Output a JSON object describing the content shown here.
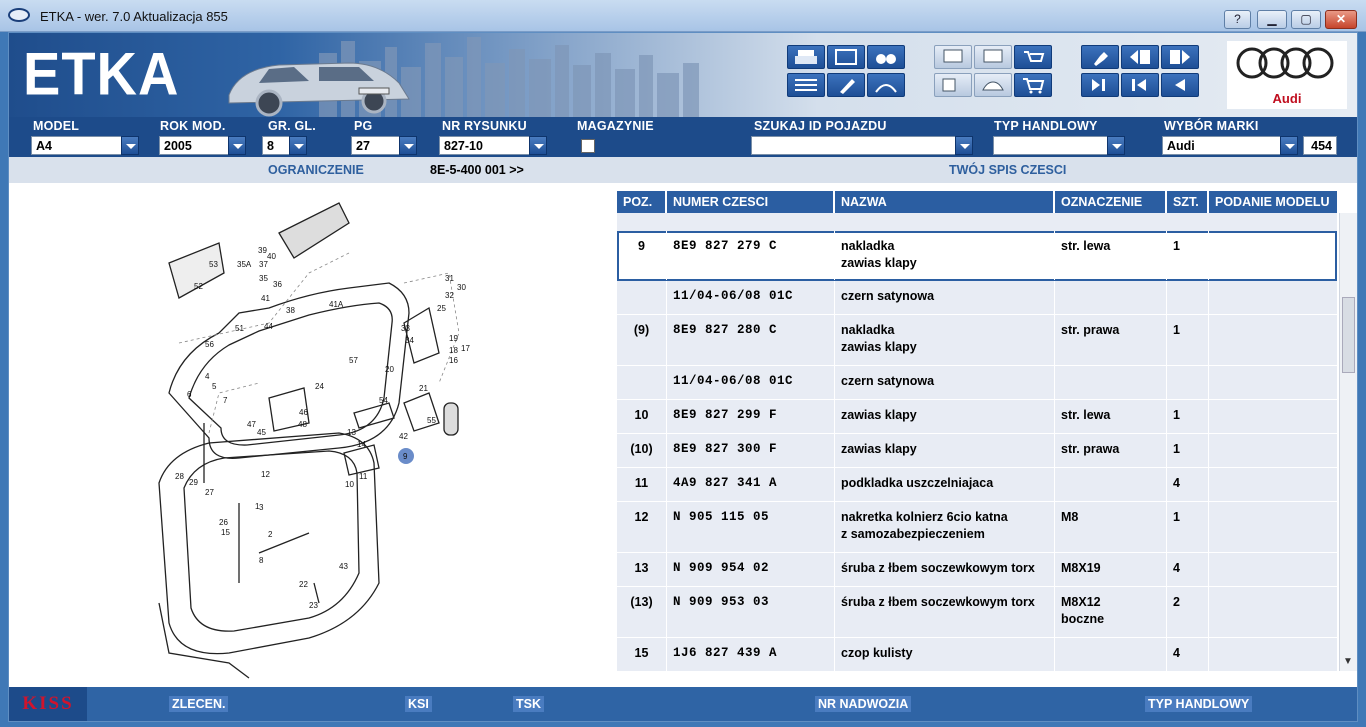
{
  "window": {
    "title": "ETKA - wer. 7.0 Aktualizacja 855",
    "help": "?",
    "minimize": "▁",
    "maximize": "▢",
    "close": "✕"
  },
  "banner": {
    "logo": "ETKA",
    "brand": "Audi"
  },
  "fields": {
    "model": {
      "label": "MODEL",
      "value": "A4"
    },
    "rok_mod": {
      "label": "ROK MOD.",
      "value": "2005"
    },
    "gr_gl": {
      "label": "GR. GL.",
      "value": "8"
    },
    "pg": {
      "label": "PG",
      "value": "27"
    },
    "nr_rysunku": {
      "label": "NR RYSUNKU",
      "value": "827-10"
    },
    "magazynie": {
      "label": "MAGAZYNIE"
    },
    "szukaj": {
      "label": "SZUKAJ ID POJAZDU",
      "value": ""
    },
    "typ_handlowy": {
      "label": "TYP HANDLOWY",
      "value": ""
    },
    "wybor_marki": {
      "label": "WYBÓR MARKI",
      "value": "Audi",
      "code": "454"
    }
  },
  "info": {
    "ograniczenie_label": "OGRANICZENIE",
    "ograniczenie_value": "8E-5-400 001 >>",
    "spis_label": "TWÓJ SPIS CZESCI"
  },
  "table": {
    "headers": [
      "POZ.",
      "NUMER CZESCI",
      "NAZWA",
      "OZNACZENIE",
      "SZT.",
      "PODANIE MODELU"
    ],
    "rows": [
      {
        "poz": "9",
        "numer": "8E9 827 279 C",
        "nazwa": "nakladka",
        "nazwa2": "zawias klapy",
        "ozn": "str. lewa",
        "ozn2": "",
        "szt": "1"
      },
      {
        "poz": "",
        "numer": "11/04-06/08 01C",
        "nazwa": "czern satynowa",
        "nazwa2": "",
        "ozn": "",
        "ozn2": "",
        "szt": ""
      },
      {
        "poz": "(9)",
        "numer": "8E9 827 280 C",
        "nazwa": "nakladka",
        "nazwa2": "zawias klapy",
        "ozn": "str. prawa",
        "ozn2": "",
        "szt": "1"
      },
      {
        "poz": "",
        "numer": "11/04-06/08 01C",
        "nazwa": "czern satynowa",
        "nazwa2": "",
        "ozn": "",
        "ozn2": "",
        "szt": ""
      },
      {
        "poz": "10",
        "numer": "8E9 827 299 F",
        "nazwa": "zawias klapy",
        "nazwa2": "",
        "ozn": "str. lewa",
        "ozn2": "",
        "szt": "1"
      },
      {
        "poz": "(10)",
        "numer": "8E9 827 300 F",
        "nazwa": "zawias klapy",
        "nazwa2": "",
        "ozn": "str. prawa",
        "ozn2": "",
        "szt": "1"
      },
      {
        "poz": "11",
        "numer": "4A9 827 341 A",
        "nazwa": "podkladka uszczelniajaca",
        "nazwa2": "",
        "ozn": "",
        "ozn2": "",
        "szt": "4"
      },
      {
        "poz": "12",
        "numer": "N   905 115 05",
        "nazwa": "nakretka kolnierz 6cio katna",
        "nazwa2": "z samozabezpieczeniem",
        "ozn": "M8",
        "ozn2": "",
        "szt": "1"
      },
      {
        "poz": "13",
        "numer": "N   909 954 02",
        "nazwa": "śruba z łbem soczewkowym torx",
        "nazwa2": "",
        "ozn": "M8X19",
        "ozn2": "",
        "szt": "4"
      },
      {
        "poz": "(13)",
        "numer": "N   909 953 03",
        "nazwa": "śruba z łbem soczewkowym torx",
        "nazwa2": "",
        "ozn": "M8X12",
        "ozn2": "boczne",
        "szt": "2"
      },
      {
        "poz": "15",
        "numer": "1J6 827 439 A",
        "nazwa": "czop kulisty",
        "nazwa2": "",
        "ozn": "",
        "ozn2": "",
        "szt": "4"
      }
    ]
  },
  "diagram": {
    "callouts": [
      "53",
      "52",
      "56",
      "51",
      "39",
      "40",
      "37",
      "35A",
      "35",
      "36",
      "41",
      "38",
      "41A",
      "44",
      "31",
      "30",
      "32",
      "25",
      "33",
      "34",
      "19",
      "18",
      "17",
      "20",
      "16",
      "21",
      "57",
      "24",
      "6",
      "5",
      "4",
      "7",
      "47",
      "46",
      "45",
      "48",
      "54",
      "55",
      "42",
      "13",
      "14",
      "9",
      "10",
      "11",
      "12",
      "28",
      "29",
      "27",
      "26",
      "1",
      "15",
      "2",
      "3",
      "8",
      "43",
      "22",
      "23",
      "9"
    ]
  },
  "status": {
    "kiss": "KISS",
    "zlecen": "ZLECEN.",
    "ksi": "KSI",
    "tsk": "TSK",
    "nr_nadwozia": "NR NADWOZIA",
    "typ_handlowy": "TYP HANDLOWY"
  }
}
